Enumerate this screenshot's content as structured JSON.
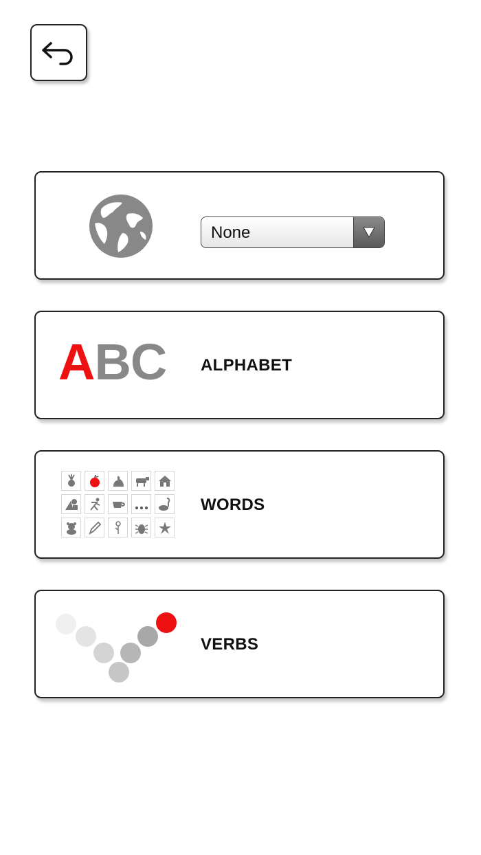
{
  "back": {
    "icon": "back-arrow-icon"
  },
  "language": {
    "icon": "globe-icon",
    "selected": "None",
    "arrow_icon": "triangle-down-icon"
  },
  "menu": {
    "alphabet": {
      "label": "ALPHABET",
      "logo_first": "A",
      "logo_rest": "BC",
      "logo_first_color": "#ee1111",
      "logo_rest_color": "#888888"
    },
    "words": {
      "label": "WORDS",
      "tiles": [
        "beet-icon",
        "apple-icon",
        "animal-icon",
        "cow-icon",
        "house-icon",
        "shapes-icon",
        "person-icon",
        "cup-icon",
        "ellipsis-icon",
        "vacuum-icon",
        "bear-icon",
        "pen-icon",
        "flower-icon",
        "bug-icon",
        "starfish-icon"
      ]
    },
    "verbs": {
      "label": "VERBS",
      "accent_color": "#ee1111"
    }
  }
}
